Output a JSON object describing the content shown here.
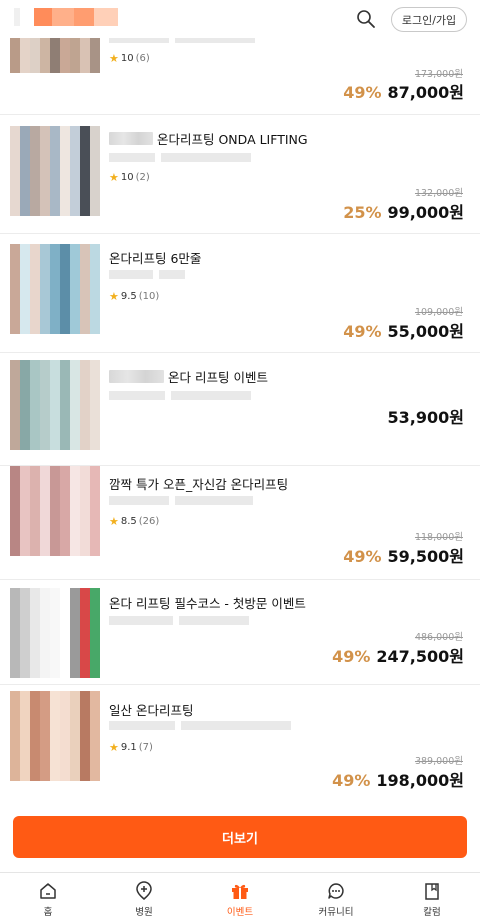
{
  "header": {
    "login_label": "로그인/가입"
  },
  "items": [
    {
      "title": "",
      "rating": "10",
      "review_count": "(6)",
      "original_price": "173,000원",
      "discount": "49%",
      "price": "87,000원"
    },
    {
      "title": "온다리프팅 ONDA LIFTING",
      "rating": "10",
      "review_count": "(2)",
      "original_price": "132,000원",
      "discount": "25%",
      "price": "99,000원"
    },
    {
      "title": "온다리프팅 6만줄",
      "rating": "9.5",
      "review_count": "(10)",
      "original_price": "109,000원",
      "discount": "49%",
      "price": "55,000원"
    },
    {
      "title": "온다 리프팅 이벤트",
      "rating": "",
      "review_count": "",
      "original_price": "",
      "discount": "",
      "price": "53,900원"
    },
    {
      "title": "깜짝 특가 오픈_자신감 온다리프팅",
      "rating": "8.5",
      "review_count": "(26)",
      "original_price": "118,000원",
      "discount": "49%",
      "price": "59,500원"
    },
    {
      "title": "온다 리프팅 필수코스 - 첫방문 이벤트",
      "rating": "",
      "review_count": "",
      "original_price": "486,000원",
      "discount": "49%",
      "price": "247,500원"
    },
    {
      "title": "일산 온다리프팅",
      "rating": "9.1",
      "review_count": "(7)",
      "original_price": "389,000원",
      "discount": "49%",
      "price": "198,000원"
    }
  ],
  "more_button": "더보기",
  "bottom_nav": [
    {
      "label": "홈",
      "icon": "home-icon"
    },
    {
      "label": "병원",
      "icon": "hospital-icon"
    },
    {
      "label": "이벤트",
      "icon": "gift-icon"
    },
    {
      "label": "커뮤니티",
      "icon": "chat-icon"
    },
    {
      "label": "칼럼",
      "icon": "bookmark-icon"
    }
  ],
  "colors": {
    "accent": "#ff5a14",
    "discount": "#d2924a",
    "star": "#f2b01e"
  }
}
